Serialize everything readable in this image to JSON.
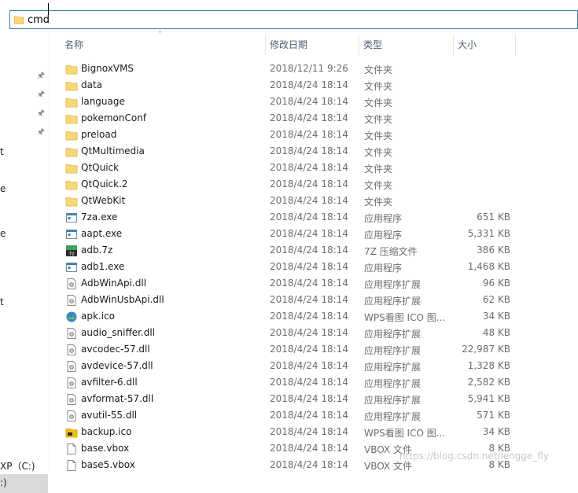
{
  "address_bar": {
    "value": "cmd"
  },
  "nav_pane": {
    "fragments": [
      {
        "text": "t"
      },
      {
        "text": "e"
      },
      {
        "text": "e"
      },
      {
        "text": "t"
      }
    ],
    "drive_label": "XP（C:)",
    "selected_label": ":)"
  },
  "columns": {
    "name": "名称",
    "date": "修改日期",
    "type": "类型",
    "size": "大小"
  },
  "files": [
    {
      "name": "BignoxVMS",
      "date": "2018/12/11 9:26",
      "type": "文件夹",
      "size": "",
      "icon": "folder-icon"
    },
    {
      "name": "data",
      "date": "2018/4/24 18:14",
      "type": "文件夹",
      "size": "",
      "icon": "folder-icon"
    },
    {
      "name": "language",
      "date": "2018/4/24 18:14",
      "type": "文件夹",
      "size": "",
      "icon": "folder-icon"
    },
    {
      "name": "pokemonConf",
      "date": "2018/4/24 18:14",
      "type": "文件夹",
      "size": "",
      "icon": "folder-icon"
    },
    {
      "name": "preload",
      "date": "2018/4/24 18:14",
      "type": "文件夹",
      "size": "",
      "icon": "folder-icon"
    },
    {
      "name": "QtMultimedia",
      "date": "2018/4/24 18:14",
      "type": "文件夹",
      "size": "",
      "icon": "folder-icon"
    },
    {
      "name": "QtQuick",
      "date": "2018/4/24 18:14",
      "type": "文件夹",
      "size": "",
      "icon": "folder-icon"
    },
    {
      "name": "QtQuick.2",
      "date": "2018/4/24 18:14",
      "type": "文件夹",
      "size": "",
      "icon": "folder-icon"
    },
    {
      "name": "QtWebKit",
      "date": "2018/4/24 18:14",
      "type": "文件夹",
      "size": "",
      "icon": "folder-icon"
    },
    {
      "name": "7za.exe",
      "date": "2018/4/24 18:14",
      "type": "应用程序",
      "size": "651 KB",
      "icon": "exe-icon"
    },
    {
      "name": "aapt.exe",
      "date": "2018/4/24 18:14",
      "type": "应用程序",
      "size": "5,331 KB",
      "icon": "exe-icon"
    },
    {
      "name": "adb.7z",
      "date": "2018/4/24 18:14",
      "type": "7Z 压缩文件",
      "size": "386 KB",
      "icon": "archive-7z-icon"
    },
    {
      "name": "adb1.exe",
      "date": "2018/4/24 18:14",
      "type": "应用程序",
      "size": "1,468 KB",
      "icon": "exe-icon"
    },
    {
      "name": "AdbWinApi.dll",
      "date": "2018/4/24 18:14",
      "type": "应用程序扩展",
      "size": "96 KB",
      "icon": "dll-icon"
    },
    {
      "name": "AdbWinUsbApi.dll",
      "date": "2018/4/24 18:14",
      "type": "应用程序扩展",
      "size": "62 KB",
      "icon": "dll-icon"
    },
    {
      "name": "apk.ico",
      "date": "2018/4/24 18:14",
      "type": "WPS看图 ICO 图...",
      "size": "34 KB",
      "icon": "image-icon"
    },
    {
      "name": "audio_sniffer.dll",
      "date": "2018/4/24 18:14",
      "type": "应用程序扩展",
      "size": "48 KB",
      "icon": "dll-icon"
    },
    {
      "name": "avcodec-57.dll",
      "date": "2018/4/24 18:14",
      "type": "应用程序扩展",
      "size": "22,987 KB",
      "icon": "dll-icon"
    },
    {
      "name": "avdevice-57.dll",
      "date": "2018/4/24 18:14",
      "type": "应用程序扩展",
      "size": "1,328 KB",
      "icon": "dll-icon"
    },
    {
      "name": "avfilter-6.dll",
      "date": "2018/4/24 18:14",
      "type": "应用程序扩展",
      "size": "2,582 KB",
      "icon": "dll-icon"
    },
    {
      "name": "avformat-57.dll",
      "date": "2018/4/24 18:14",
      "type": "应用程序扩展",
      "size": "5,941 KB",
      "icon": "dll-icon"
    },
    {
      "name": "avutil-55.dll",
      "date": "2018/4/24 18:14",
      "type": "应用程序扩展",
      "size": "571 KB",
      "icon": "dll-icon"
    },
    {
      "name": "backup.ico",
      "date": "2018/4/24 18:14",
      "type": "WPS看图 ICO 图...",
      "size": "34 KB",
      "icon": "folder-image-icon"
    },
    {
      "name": "base.vbox",
      "date": "2018/4/24 18:14",
      "type": "VBOX 文件",
      "size": "8 KB",
      "icon": "file-icon"
    },
    {
      "name": "base5.vbox",
      "date": "2018/4/24 18:14",
      "type": "VBOX 文件",
      "size": "8 KB",
      "icon": "file-icon"
    }
  ],
  "watermark": "https://blog.csdn.net/lengge_fly",
  "colors": {
    "accent": "#3c7fb1",
    "folder": "#f8d775",
    "header_text": "#4c607a",
    "selected_nav": "#d9d9d9"
  }
}
